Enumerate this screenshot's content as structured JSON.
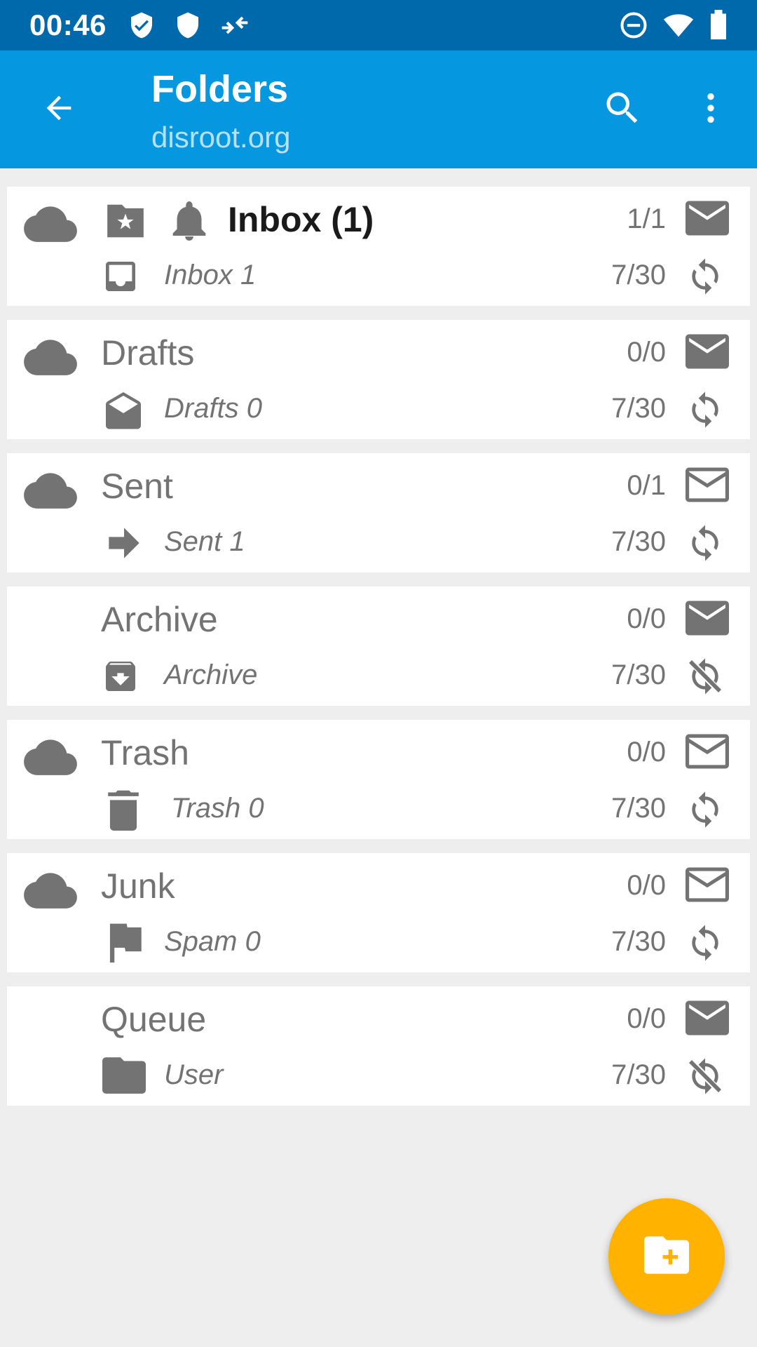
{
  "status_bar": {
    "time": "00:46",
    "icons": [
      "shield-check-icon",
      "shield-icon",
      "data-saver-icon",
      "dnd-icon",
      "wifi-icon",
      "battery-icon"
    ]
  },
  "app_bar": {
    "title": "Folders",
    "subtitle": "disroot.org",
    "back_icon": "arrow-back-icon",
    "search_icon": "search-icon",
    "menu_icon": "more-vert-icon"
  },
  "colors": {
    "status_bar": "#0069ac",
    "app_bar": "#0598e0",
    "background": "#eeeeee",
    "icon_gray": "#737373",
    "fab": "#ffb300"
  },
  "folders": [
    {
      "name": "Inbox (1)",
      "count": "1/1",
      "sub": "Inbox  1",
      "sync_count": "7/30",
      "bold": true,
      "cloud": true,
      "notify": true,
      "mail_icon": "mail-filled-icon",
      "type_icon": "inbox-icon",
      "sync_icon": "sync-icon"
    },
    {
      "name": "Drafts",
      "count": "0/0",
      "sub": "Drafts  0",
      "sync_count": "7/30",
      "bold": false,
      "cloud": true,
      "mail_icon": "mail-filled-icon",
      "type_icon": "drafts-icon",
      "sync_icon": "sync-icon"
    },
    {
      "name": "Sent",
      "count": "0/1",
      "sub": "Sent  1",
      "sync_count": "7/30",
      "bold": false,
      "cloud": true,
      "mail_icon": "mail-outline-icon",
      "type_icon": "send-arrow-icon",
      "sync_icon": "sync-icon"
    },
    {
      "name": "Archive",
      "count": "0/0",
      "sub": "Archive",
      "sync_count": "7/30",
      "bold": false,
      "cloud": false,
      "mail_icon": "mail-filled-icon",
      "type_icon": "archive-icon",
      "sync_icon": "sync-disabled-icon"
    },
    {
      "name": "Trash",
      "count": "0/0",
      "sub": "Trash  0",
      "sync_count": "7/30",
      "bold": false,
      "cloud": true,
      "mail_icon": "mail-outline-icon",
      "type_icon": "trash-icon",
      "sync_icon": "sync-icon"
    },
    {
      "name": "Junk",
      "count": "0/0",
      "sub": "Spam  0",
      "sync_count": "7/30",
      "bold": false,
      "cloud": true,
      "mail_icon": "mail-outline-icon",
      "type_icon": "flag-icon",
      "sync_icon": "sync-icon"
    },
    {
      "name": "Queue",
      "count": "0/0",
      "sub": "User",
      "sync_count": "7/30",
      "bold": false,
      "cloud": false,
      "mail_icon": "mail-filled-icon",
      "type_icon": "folder-icon",
      "sync_icon": "sync-disabled-icon"
    }
  ],
  "fab": {
    "icon": "create-new-folder-icon"
  }
}
